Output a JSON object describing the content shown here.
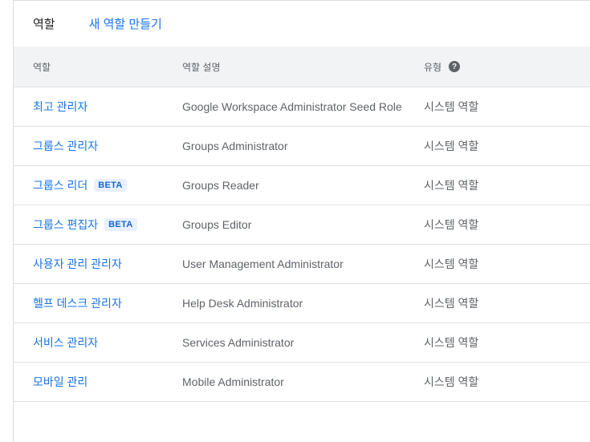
{
  "header": {
    "title": "역할",
    "create_link": "새 역할 만들기"
  },
  "table": {
    "columns": {
      "name": "역할",
      "description": "역할 설명",
      "type": "유형",
      "help_icon": "?"
    },
    "rows": [
      {
        "name": "최고 관리자",
        "badge": "",
        "description": "Google Workspace Administrator Seed Role",
        "type": "시스템 역할"
      },
      {
        "name": "그룹스 관리자",
        "badge": "",
        "description": "Groups Administrator",
        "type": "시스템 역할"
      },
      {
        "name": "그룹스 리더",
        "badge": "BETA",
        "description": "Groups Reader",
        "type": "시스템 역할"
      },
      {
        "name": "그룹스 편집자",
        "badge": "BETA",
        "description": "Groups Editor",
        "type": "시스템 역할"
      },
      {
        "name": "사용자 관리 관리자",
        "badge": "",
        "description": "User Management Administrator",
        "type": "시스템 역할"
      },
      {
        "name": "헬프 데스크 관리자",
        "badge": "",
        "description": "Help Desk Administrator",
        "type": "시스템 역할"
      },
      {
        "name": "서비스 관리자",
        "badge": "",
        "description": "Services Administrator",
        "type": "시스템 역할"
      },
      {
        "name": "모바일 관리",
        "badge": "",
        "description": "Mobile Administrator",
        "type": "시스템 역할"
      }
    ]
  },
  "colors": {
    "link": "#1a73e8",
    "header_bg": "#f1f3f4",
    "badge_bg": "#e8f0fe",
    "badge_text": "#1967d2"
  }
}
